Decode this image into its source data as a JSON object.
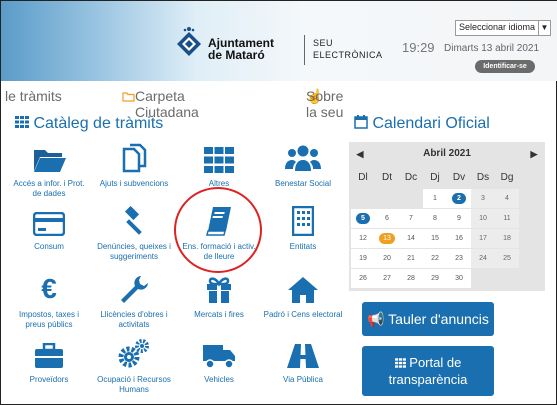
{
  "header": {
    "language_select": "Seleccionar idioma",
    "org_name_line1": "Ajuntament",
    "org_name_line2": "de Mataró",
    "seu_line1": "SEU",
    "seu_line2": "ELECTRÒNICA",
    "time": "19:29",
    "date": "Dimarts 13 abril 2021",
    "login_label": "Identificar-se"
  },
  "nav": {
    "item1": "le tràmits",
    "item2": "Carpeta Ciutadana",
    "item3": "Sobre la seu"
  },
  "catalog": {
    "title": "Catàleg de tràmits",
    "tiles": [
      {
        "label": "Accés a infor. i Prot. de dades",
        "icon": "folder-icon"
      },
      {
        "label": "Ajuts i subvencions",
        "icon": "copy-icon"
      },
      {
        "label": "Altres",
        "icon": "grid-icon"
      },
      {
        "label": "Benestar Social",
        "icon": "users-icon"
      },
      {
        "label": "Consum",
        "icon": "credit-card-icon"
      },
      {
        "label": "Denúncies, queixes i suggeriments",
        "icon": "gavel-icon"
      },
      {
        "label": "Ens. formació i activ. de lleure",
        "icon": "book-icon"
      },
      {
        "label": "Entitats",
        "icon": "building-icon"
      },
      {
        "label": "Impostos, taxes i preus públics",
        "icon": "euro-icon"
      },
      {
        "label": "Llicències d'obres i activitats",
        "icon": "wrench-icon"
      },
      {
        "label": "Mercats i fires",
        "icon": "gift-icon"
      },
      {
        "label": "Padró i Cens electoral",
        "icon": "home-icon"
      },
      {
        "label": "Proveïdors",
        "icon": "briefcase-icon"
      },
      {
        "label": "Ocupació i Recursos Humans",
        "icon": "cogs-icon"
      },
      {
        "label": "Vehicles",
        "icon": "truck-icon"
      },
      {
        "label": "Via Pública",
        "icon": "road-icon"
      }
    ]
  },
  "calendar": {
    "title": "Calendari Oficial",
    "month": "Abril 2021",
    "weekdays": [
      "Dl",
      "Dt",
      "Dc",
      "Dj",
      "Dv",
      "Ds",
      "Dg"
    ],
    "weeks": [
      [
        "",
        "",
        "",
        "1",
        "2",
        "3",
        "4"
      ],
      [
        "5",
        "6",
        "7",
        "8",
        "9",
        "10",
        "11"
      ],
      [
        "12",
        "13",
        "14",
        "15",
        "16",
        "17",
        "18"
      ],
      [
        "19",
        "20",
        "21",
        "22",
        "23",
        "24",
        "25"
      ],
      [
        "26",
        "27",
        "28",
        "29",
        "30",
        "",
        ""
      ]
    ],
    "highlight_blue": [
      "2",
      "5"
    ],
    "highlight_orange": [
      "13"
    ]
  },
  "buttons": {
    "tauler": "Tauler d'anuncis",
    "portal_line1": "Portal de",
    "portal_line2": "transparència"
  },
  "colors": {
    "accent": "#1a6fb0",
    "orange": "#f0a020",
    "highlight_circle": "#dd2222"
  }
}
